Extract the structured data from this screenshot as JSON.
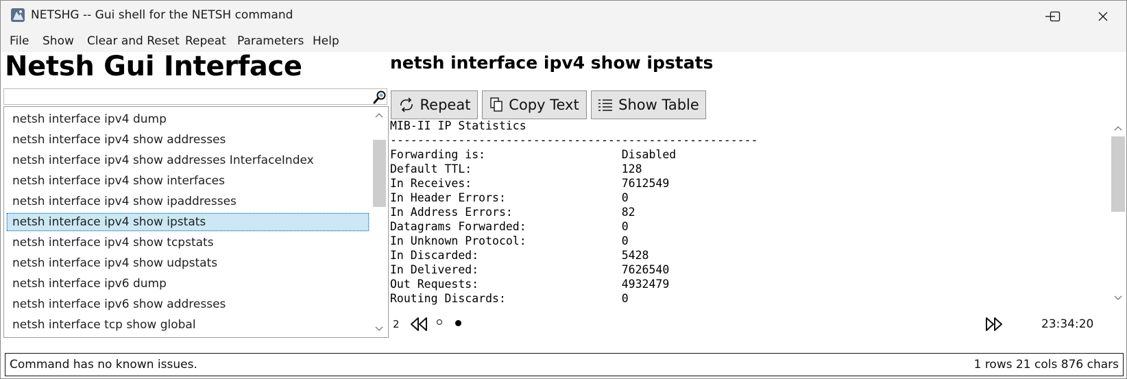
{
  "window": {
    "title": "NETSHG -- Gui shell for the NETSH command"
  },
  "menu": [
    {
      "label": "File"
    },
    {
      "label": "Show"
    },
    {
      "label": "Clear and Reset"
    },
    {
      "label": "Repeat"
    },
    {
      "label": "Parameters"
    },
    {
      "label": "Help"
    }
  ],
  "left_panel": {
    "heading": "Netsh Gui Interface",
    "search": {
      "value": "",
      "placeholder": ""
    },
    "commands": [
      {
        "label": "netsh interface ipv4 dump"
      },
      {
        "label": "netsh interface ipv4 show addresses"
      },
      {
        "label": "netsh interface ipv4 show addresses InterfaceIndex"
      },
      {
        "label": "netsh interface ipv4 show interfaces"
      },
      {
        "label": "netsh interface ipv4 show ipaddresses"
      },
      {
        "label": "netsh interface ipv4 show ipstats",
        "selected": true
      },
      {
        "label": "netsh interface ipv4 show tcpstats"
      },
      {
        "label": "netsh interface ipv4 show udpstats"
      },
      {
        "label": "netsh interface ipv6 dump"
      },
      {
        "label": "netsh interface ipv6 show addresses"
      },
      {
        "label": "netsh interface tcp show global"
      }
    ]
  },
  "right_panel": {
    "command_title": "netsh interface ipv4 show ipstats",
    "buttons": {
      "repeat": "Repeat",
      "copy": "Copy Text",
      "table": "Show Table"
    },
    "output_lines": [
      "MIB-II IP Statistics",
      "------------------------------------------------------",
      "Forwarding is:                    Disabled",
      "Default TTL:                      128",
      "In Receives:                      7612549",
      "In Header Errors:                 0",
      "In Address Errors:                82",
      "Datagrams Forwarded:              0",
      "In Unknown Protocol:              0",
      "In Discarded:                     5428",
      "In Delivered:                     7626540",
      "Out Requests:                     4932479",
      "Routing Discards:                 0"
    ],
    "nav": {
      "page": "2",
      "time": "23:34:20"
    }
  },
  "status": {
    "message": "Command has no known issues.",
    "stats": "1 rows 21 cols 876 chars"
  }
}
